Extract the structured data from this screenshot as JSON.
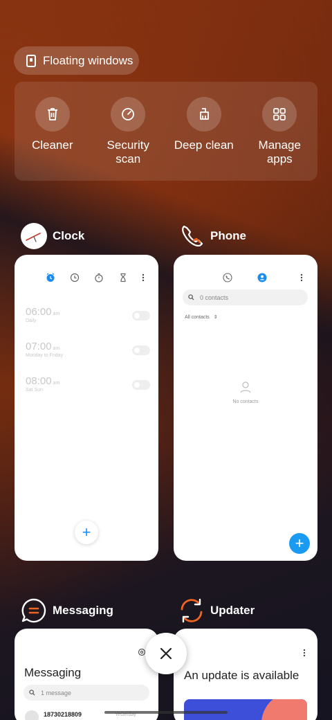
{
  "floating_windows": {
    "label": "Floating windows"
  },
  "tools": [
    {
      "label": "Cleaner",
      "icon": "trash-icon"
    },
    {
      "label": "Security scan",
      "icon": "security-scan-icon"
    },
    {
      "label": "Deep clean",
      "icon": "deep-clean-icon"
    },
    {
      "label": "Manage apps",
      "icon": "grid-icon"
    }
  ],
  "apps": {
    "clock": {
      "name": "Clock",
      "alarms": [
        {
          "time": "06:00",
          "ampm": "am",
          "repeat": "Daily"
        },
        {
          "time": "07:00",
          "ampm": "am",
          "repeat": "Monday to Friday"
        },
        {
          "time": "08:00",
          "ampm": "am",
          "repeat": "Sat Sun"
        }
      ],
      "add": "+"
    },
    "phone": {
      "name": "Phone",
      "search_placeholder": "0 contacts",
      "filter": "All contacts",
      "empty": "No contacts",
      "add": "+"
    },
    "messaging": {
      "name": "Messaging",
      "title": "Messaging",
      "search_placeholder": "1 message",
      "first_sender": "18730218809",
      "first_meta": "Yesterday"
    },
    "updater": {
      "name": "Updater",
      "title": "An update is available"
    }
  },
  "colors": {
    "accent": "#1a9af0",
    "brand_orange": "#f06423"
  }
}
